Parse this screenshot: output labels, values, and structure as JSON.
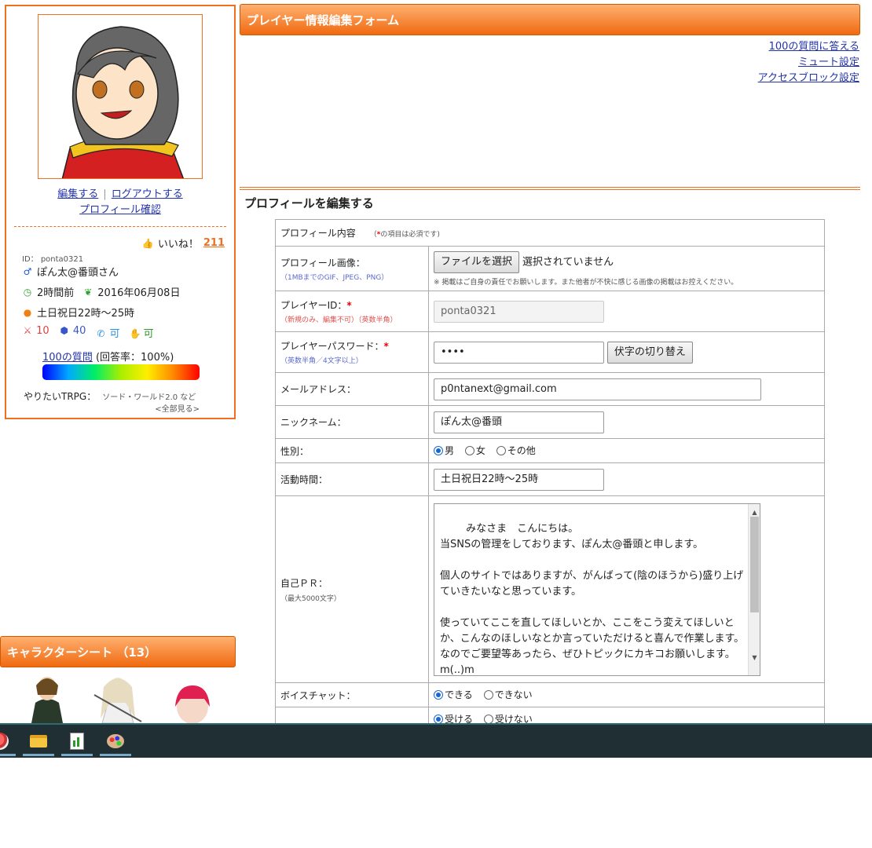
{
  "profile": {
    "edit_link": "編集する",
    "logout_link": "ログアウトする",
    "separator": "|",
    "confirm_link": "プロフィール確認",
    "like_label": "いいね！",
    "like_count": "211",
    "id_label": "ID： ponta0321",
    "nickname": "ぽん太@番頭さん",
    "last_login": "2時間前",
    "registered": "2016年06月08日",
    "active_time": "土日祝日22時～25時",
    "stat_sword": "10",
    "stat_dice": "40",
    "stat_voice": "可",
    "stat_hand": "可",
    "q100_link": "100の質問",
    "q100_rate": " (回答率：100%)",
    "trpg_label": "やりたいTRPG：",
    "trpg_value": "ソード・ワールド2.0 など",
    "see_all": "<全部見る>"
  },
  "character_sheet": {
    "title": "キャラクターシート （13）"
  },
  "main": {
    "header_title": "プレイヤー情報編集フォーム",
    "link_100q": "100の質問に答える",
    "link_mute": "ミュート設定",
    "link_block": "アクセスブロック設定",
    "section_title": "プロフィールを編集する"
  },
  "form": {
    "profile_content_label": "プロフィール内容",
    "required_mark": "*",
    "required_note": "の項目は必須です)",
    "required_open": "（",
    "image_label": "プロフィール画像：",
    "image_note": "（1MBまでのGIF、JPEG、PNG）",
    "file_button": "ファイルを選択",
    "file_status": "選択されていません",
    "image_disclaimer": "※ 掲載はご自身の責任でお願いします。また他者が不快に感じる画像の掲載はお控えください。",
    "player_id_label": "プレイヤーID：",
    "player_id_note": "（新規のみ、編集不可）（英数半角）",
    "player_id_value": "ponta0321",
    "password_label": "プレイヤーパスワード：",
    "password_note": "（英数半角／4文字以上）",
    "password_value": "••••",
    "password_toggle": "伏字の切り替え",
    "email_label": "メールアドレス：",
    "email_value": "p0ntanext@gmail.com",
    "nickname_label": "ニックネーム：",
    "nickname_value": "ぽん太@番頭",
    "gender_label": "性別：",
    "gender_male": "男",
    "gender_female": "女",
    "gender_other": "その他",
    "active_label": "活動時間：",
    "active_value": "土日祝日22時～25時",
    "pr_label": "自己ＰＲ：",
    "pr_note": "（最大5000文字）",
    "pr_text": "みなさま　こんにちは。\n当SNSの管理をしております、ぽん太@番頭と申します。\n\n個人のサイトではありますが、がんばって(陰のほうから)盛り上げていきたいなと思っています。\n\n使っていてここを直してほしいとか、ここをこう変えてほしいとか、こんなのほしいなとか言っていただけると喜んで作業します。なのでご要望等あったら、ぜひトピックにカキコお願いします。m(..)m",
    "voice_label": "ボイスチャット：",
    "voice_yes": "できる",
    "voice_no": "できない",
    "accept_yes": "受ける",
    "accept_no": "受けない"
  },
  "colors": {
    "accent": "#f07020",
    "link": "#2233aa",
    "required": "#e00000",
    "taskbar": "#1f2f33"
  }
}
